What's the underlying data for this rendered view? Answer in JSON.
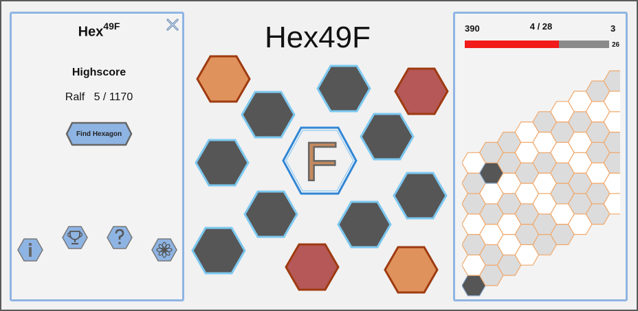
{
  "left_panel": {
    "title": "Hex",
    "title_sup": "49F",
    "close_icon": "close-icon",
    "highscore_heading": "Highscore",
    "highscore_name": "Ralf",
    "highscore_value": "5 / 1170",
    "find_button_label": "Find Hexagon",
    "footer_icons": [
      {
        "name": "info-icon",
        "glyph": "i"
      },
      {
        "name": "trophy-icon",
        "glyph": "trophy"
      },
      {
        "name": "help-icon",
        "glyph": "?"
      },
      {
        "name": "settings-flower-icon",
        "glyph": "flower"
      }
    ]
  },
  "center": {
    "title": "Hex49F",
    "target_letter": "F",
    "tiles": [
      {
        "color": "orange"
      },
      {
        "color": "gray-blue"
      },
      {
        "color": "red"
      },
      {
        "color": "gray-blue"
      },
      {
        "color": "gray-blue"
      },
      {
        "color": "gray-blue"
      },
      {
        "color": "gray-blue"
      },
      {
        "color": "gray-blue"
      },
      {
        "color": "gray-blue"
      },
      {
        "color": "gray-blue"
      },
      {
        "color": "red"
      },
      {
        "color": "orange"
      }
    ]
  },
  "right_panel": {
    "score": "390",
    "progress": "4 / 28",
    "lives": "3",
    "bar_value": "26",
    "bar_fraction": 0.65,
    "found_cells": 2
  },
  "colors": {
    "panel_border": "#8eb4e3",
    "hex_dark": "#565656",
    "hex_blue_border": "#7cc8f0",
    "hex_orange": "#e0925c",
    "hex_orange_border": "#9e3a10",
    "hex_red": "#b55857",
    "hex_red_border": "#9e3a10",
    "bar_red": "#f21a1a",
    "grid_cell": "#dcdcdc",
    "grid_border": "#f0a86b"
  }
}
